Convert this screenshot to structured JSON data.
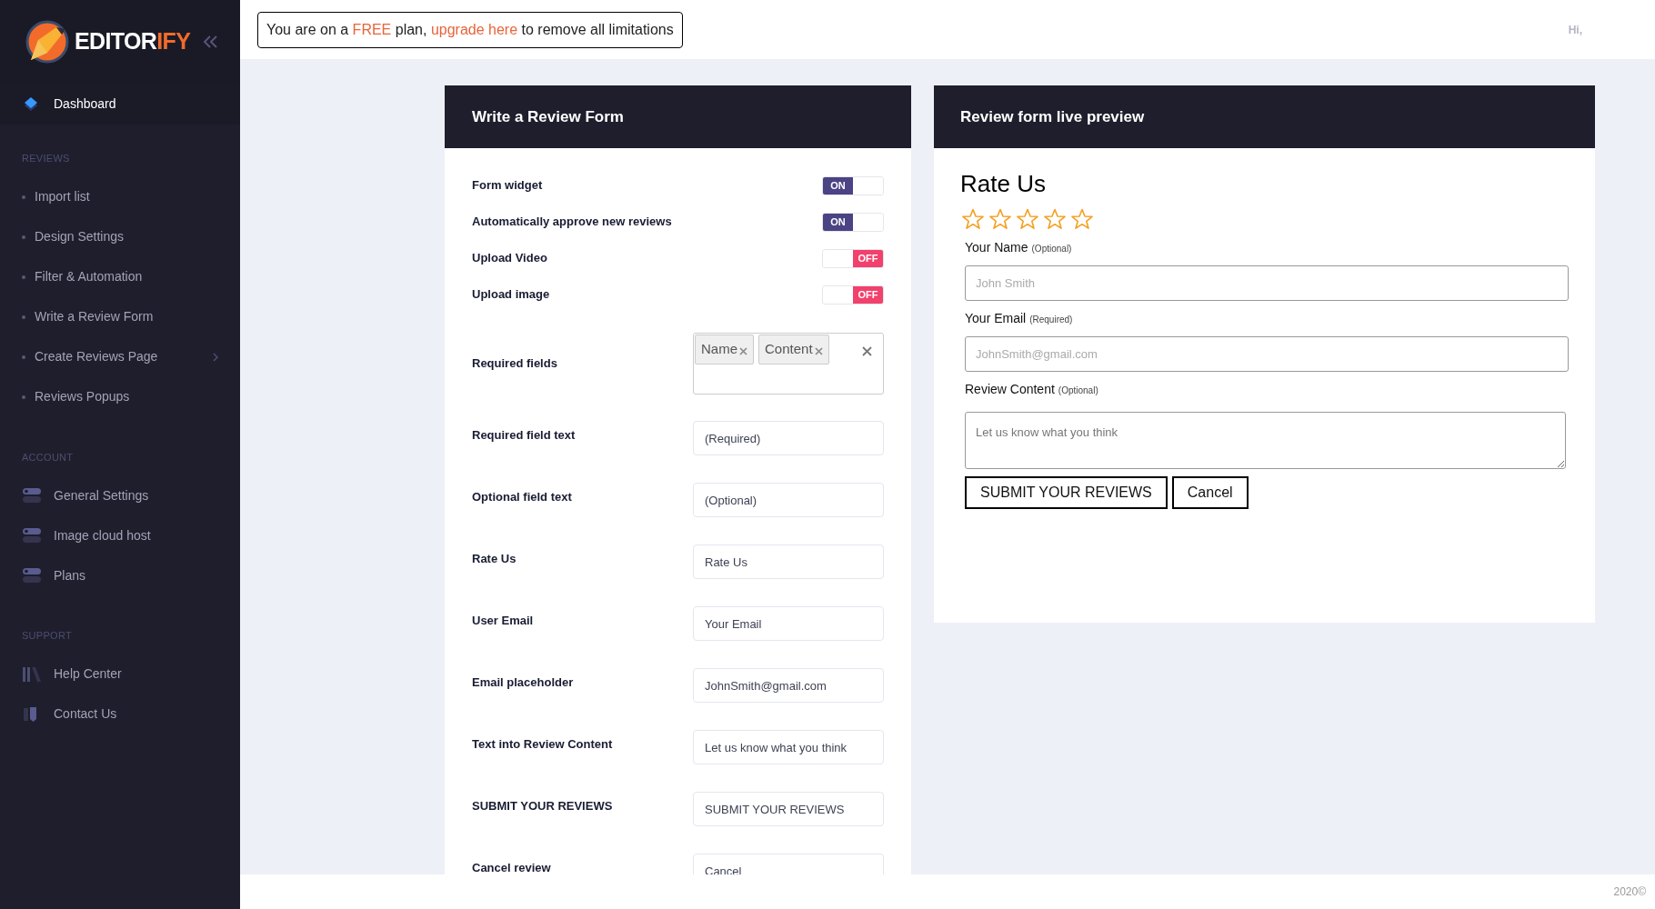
{
  "brand": {
    "name_main": "EDITOR",
    "name_accent": "IFY"
  },
  "sidebar": {
    "top_item": {
      "label": "Dashboard",
      "selected": true
    },
    "sections": [
      {
        "title": "REVIEWS",
        "items": [
          {
            "label": "Import list",
            "kind": "bullet",
            "selected": false,
            "expandable": false
          },
          {
            "label": "Design Settings",
            "kind": "bullet",
            "selected": false,
            "expandable": false
          },
          {
            "label": "Filter & Automation",
            "kind": "bullet",
            "selected": false,
            "expandable": false
          },
          {
            "label": "Write a Review Form",
            "kind": "bullet",
            "selected": false,
            "expandable": false
          },
          {
            "label": "Create Reviews Page",
            "kind": "bullet",
            "selected": false,
            "expandable": true
          },
          {
            "label": "Reviews Popups",
            "kind": "bullet",
            "selected": false,
            "expandable": false
          }
        ]
      },
      {
        "title": "ACCOUNT",
        "items": [
          {
            "label": "General Settings",
            "kind": "switches",
            "selected": false,
            "expandable": false
          },
          {
            "label": "Image cloud host",
            "kind": "switches",
            "selected": false,
            "expandable": false
          },
          {
            "label": "Plans",
            "kind": "switches",
            "selected": false,
            "expandable": false
          }
        ]
      },
      {
        "title": "SUPPORT",
        "items": [
          {
            "label": "Help Center",
            "kind": "books",
            "selected": false,
            "expandable": false
          },
          {
            "label": "Contact Us",
            "kind": "contact",
            "selected": false,
            "expandable": false
          }
        ]
      }
    ]
  },
  "banner": {
    "parts": [
      {
        "text": "You are on a ",
        "kind": "plain"
      },
      {
        "text": "FREE",
        "kind": "accent"
      },
      {
        "text": " plan, ",
        "kind": "plain"
      },
      {
        "text": "upgrade here",
        "kind": "link"
      },
      {
        "text": " to remove all limitations",
        "kind": "plain"
      }
    ]
  },
  "greeting": "Hi,",
  "form_panel": {
    "title": "Write a Review Form",
    "rows": [
      {
        "kind": "toggle",
        "label": "Form widget",
        "on": true,
        "text": "ON"
      },
      {
        "kind": "toggle",
        "label": "Automatically approve new reviews",
        "on": true,
        "text": "ON"
      },
      {
        "kind": "toggle",
        "label": "Upload Video",
        "on": false,
        "text": "OFF"
      },
      {
        "kind": "toggle",
        "label": "Upload image",
        "on": false,
        "text": "OFF"
      },
      {
        "kind": "tags",
        "label": "Required fields",
        "tags": [
          "Name",
          "Content"
        ]
      },
      {
        "kind": "text",
        "label": "Required field text",
        "value": "(Required)"
      },
      {
        "kind": "text",
        "label": "Optional field text",
        "value": "(Optional)"
      },
      {
        "kind": "text",
        "label": "Rate Us",
        "value": "Rate Us"
      },
      {
        "kind": "text",
        "label": "User Email",
        "value": "Your Email"
      },
      {
        "kind": "text",
        "label": "Email placeholder",
        "value": "JohnSmith@gmail.com"
      },
      {
        "kind": "text",
        "label": "Text into Review Content",
        "value": "Let us know what you think"
      },
      {
        "kind": "text",
        "label": "SUBMIT YOUR REVIEWS",
        "value": "SUBMIT YOUR REVIEWS"
      },
      {
        "kind": "text",
        "label": "Cancel review",
        "value": "Cancel"
      }
    ]
  },
  "preview_panel": {
    "title": "Review form live preview",
    "heading": "Rate Us",
    "stars": 0,
    "fields": [
      {
        "kind": "input",
        "label": "Your Name",
        "note": "(Optional)",
        "placeholder": "John Smith"
      },
      {
        "kind": "input",
        "label": "Your Email",
        "note": "(Required)",
        "placeholder": "JohnSmith@gmail.com"
      },
      {
        "kind": "textarea",
        "label": "Review Content",
        "note": "(Optional)",
        "placeholder": "Let us know what you think"
      }
    ],
    "buttons": [
      "SUBMIT YOUR REVIEWS",
      "Cancel"
    ]
  },
  "footer": "2020©"
}
